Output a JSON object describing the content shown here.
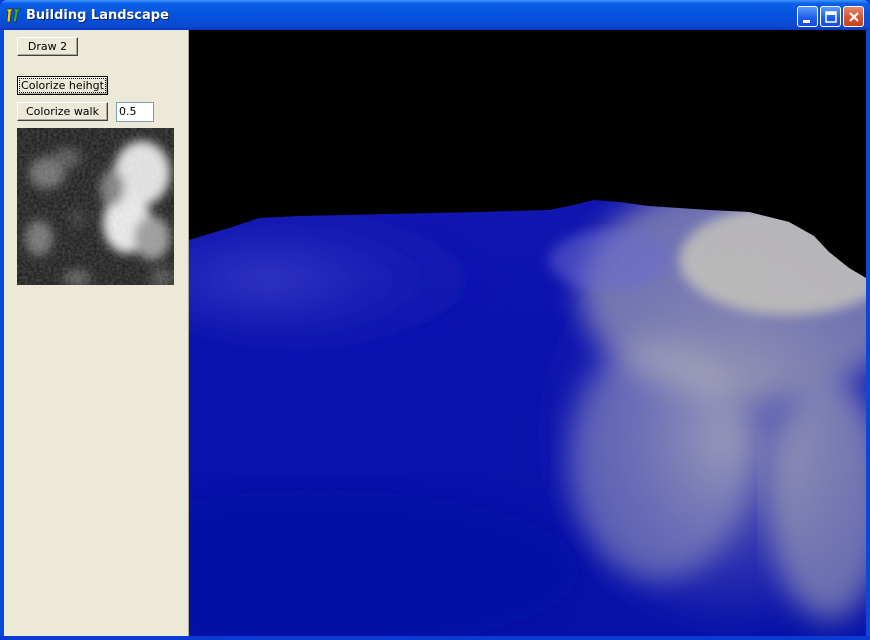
{
  "window": {
    "title": "Building Landscape",
    "icon": "app-logo-icon",
    "controls": [
      "minimize-icon",
      "maximize-icon",
      "close-icon"
    ]
  },
  "sidebar": {
    "draw_button": "Draw 2",
    "colorize_height_button": "Colorize heihgt",
    "colorize_walk_button": "Colorize walk",
    "walk_value": "0.5"
  },
  "colors": {
    "titlebar": "#0752dc",
    "panel": "#ece9d8",
    "terrain_low": "#0a14b4",
    "terrain_high": "#cfcdb8",
    "sky": "#000000"
  }
}
